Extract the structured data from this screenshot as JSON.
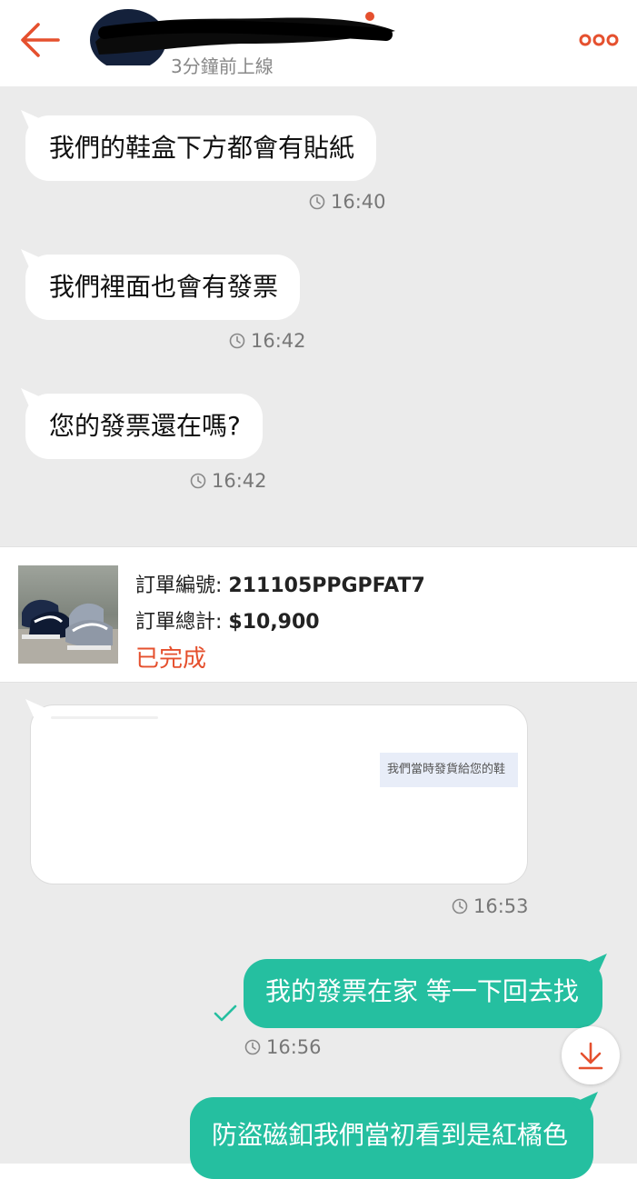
{
  "header": {
    "status": "3分鐘前上線",
    "accent_color": "#e5502e"
  },
  "messages": {
    "m1": {
      "text": "我們的鞋盒下方都會有貼紙",
      "time": "16:40"
    },
    "m2": {
      "text": "我們裡面也會有發票",
      "time": "16:42"
    },
    "m3": {
      "text": "您的發票還在嗎?",
      "time": "16:42"
    },
    "image_message": {
      "snippet": "我們當時發貨給您的鞋",
      "time": "16:53"
    },
    "m4": {
      "text": "我的發票在家 等一下回去找",
      "time": "16:56"
    },
    "m5": {
      "text": "防盜磁釦我們當初看到是紅橘色"
    }
  },
  "order": {
    "number_label": "訂單編號: ",
    "number": "211105PPGPFAT7",
    "total_label": "訂單總計: ",
    "total": "$10,900",
    "status": "已完成",
    "status_color": "#e5502e"
  },
  "colors": {
    "outgoing_bubble": "#25bfa0",
    "chat_background": "#ebebeb"
  },
  "icons": {
    "back": "arrow-left-icon",
    "more": "more-dots-icon",
    "clock": "clock-icon",
    "sent": "checkmark-icon",
    "scroll": "arrow-down-icon"
  }
}
